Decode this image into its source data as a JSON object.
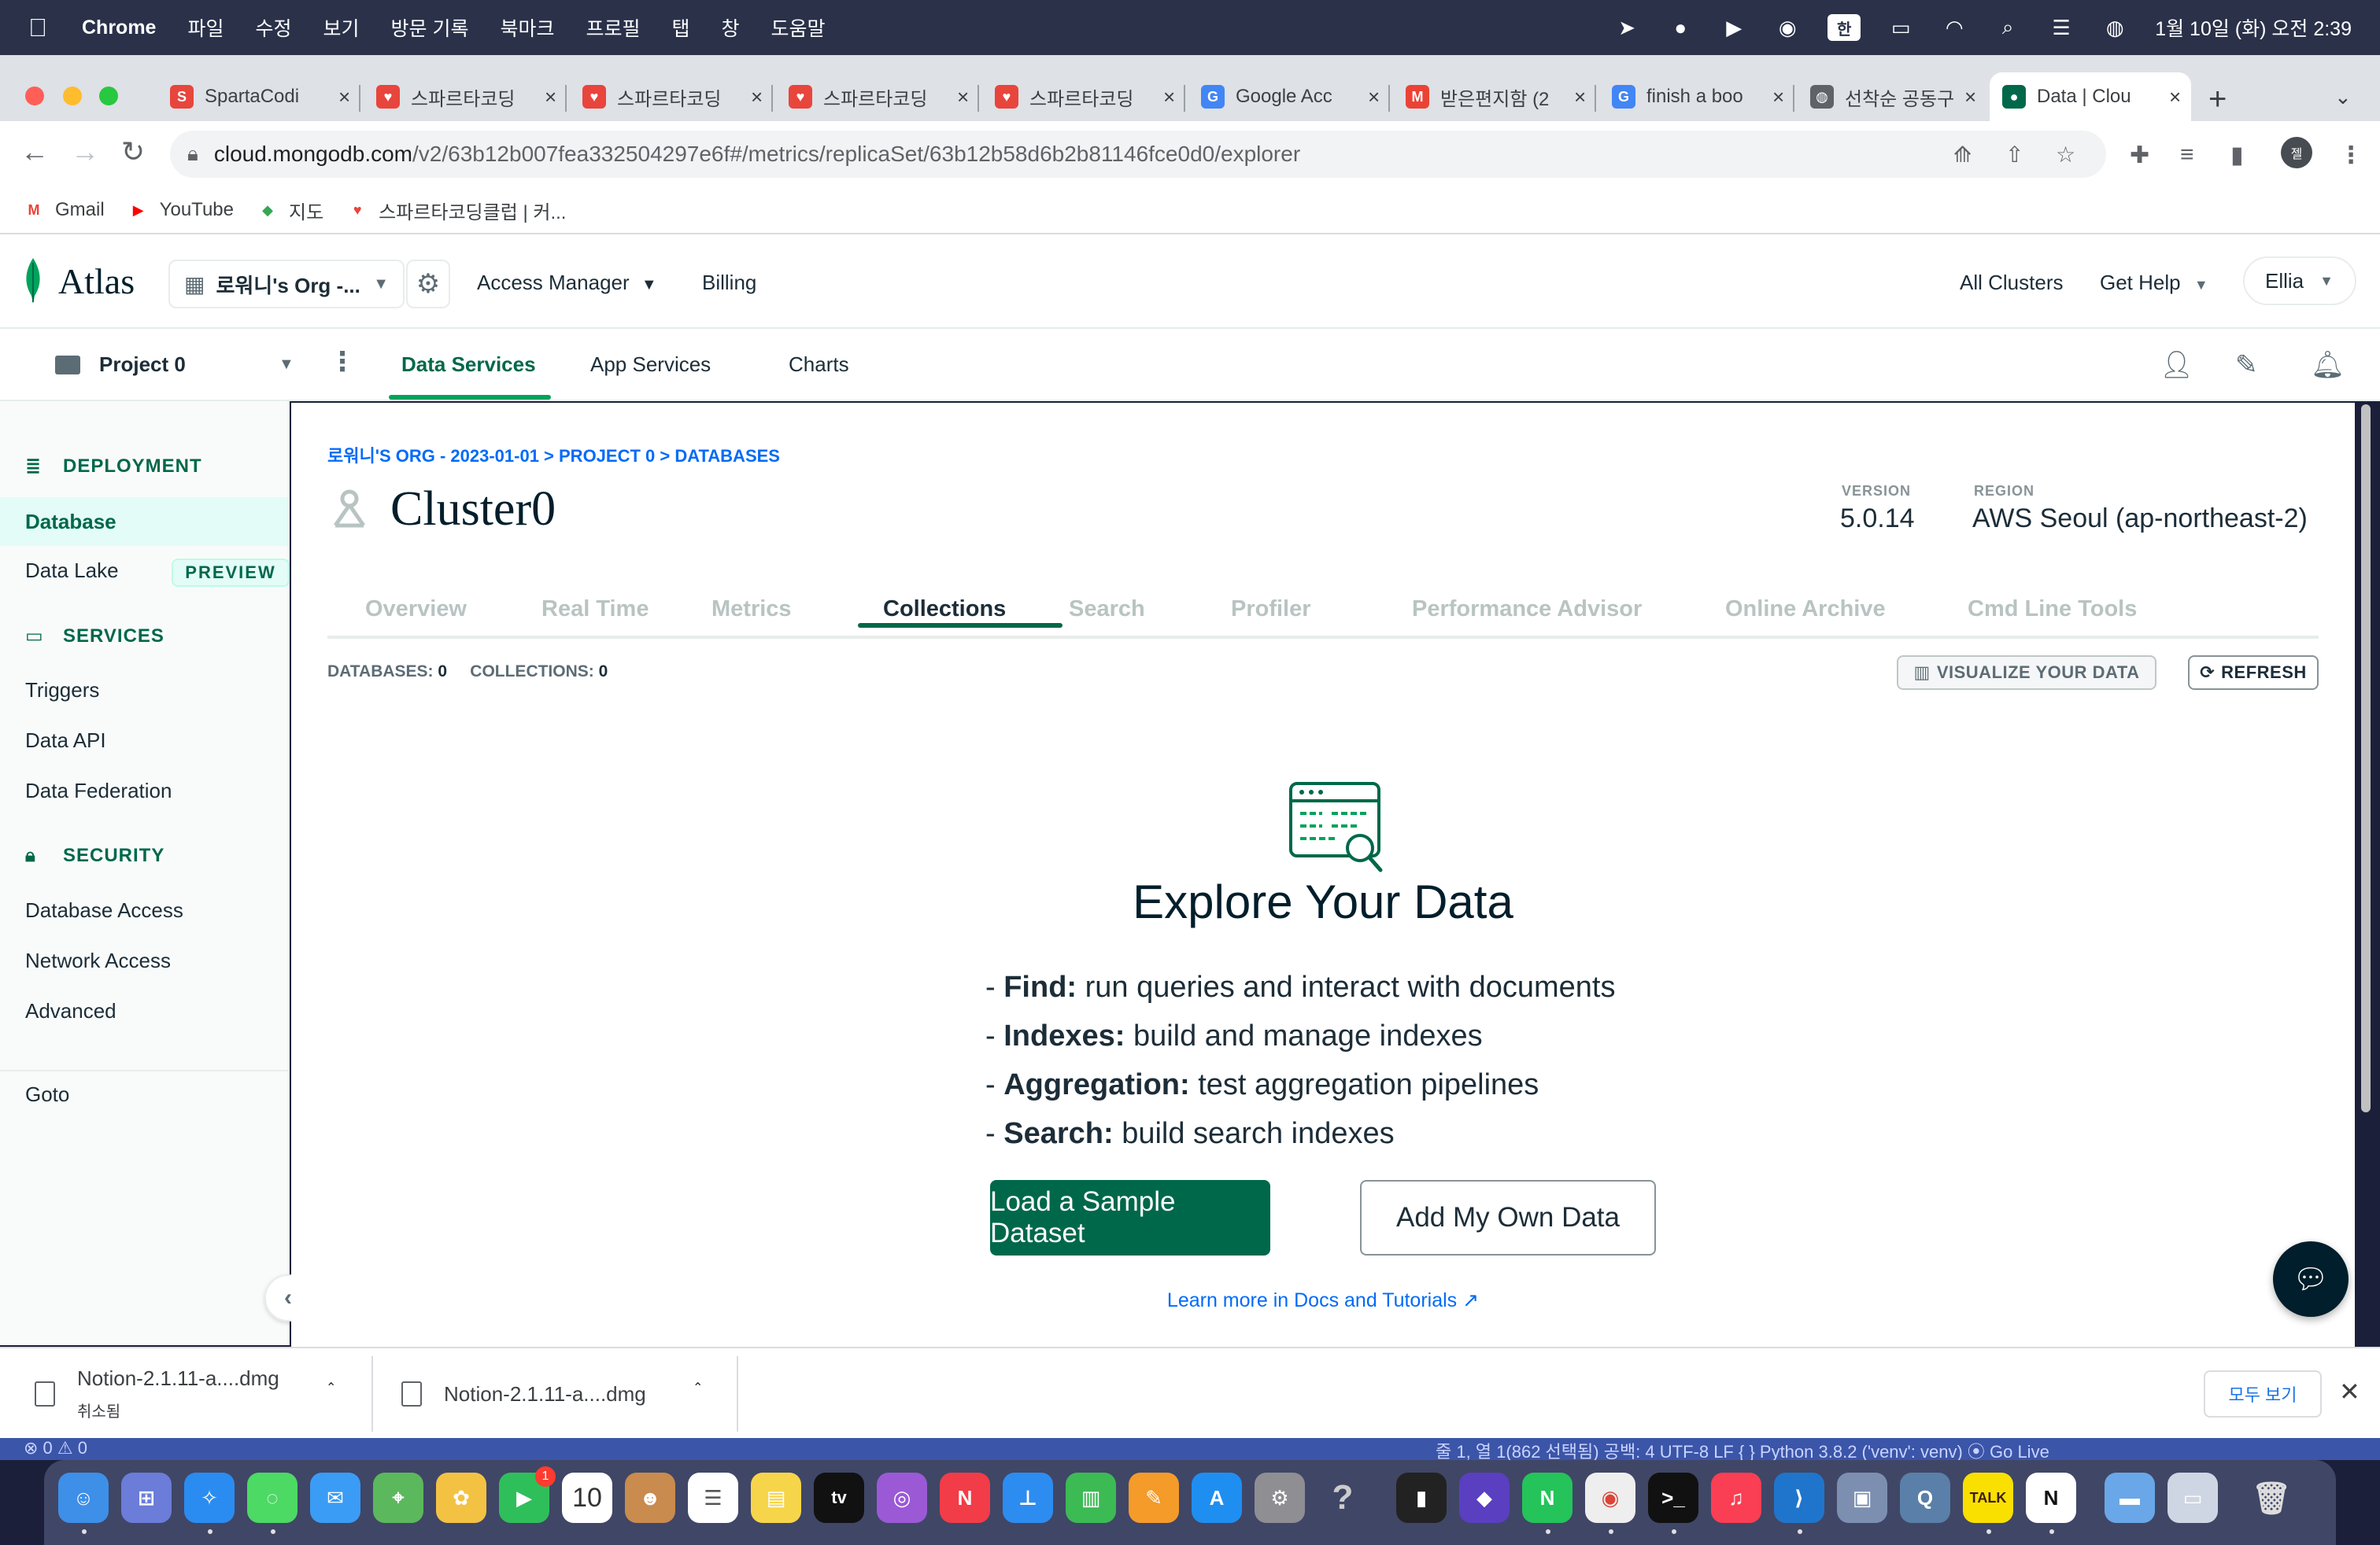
{
  "menubar": {
    "app": "Chrome",
    "items": [
      "파일",
      "수정",
      "보기",
      "방문 기록",
      "북마크",
      "프로필",
      "탭",
      "창",
      "도움말"
    ],
    "ime": "한",
    "datetime": "1월 10일 (화) 오전 2:39"
  },
  "tabs": [
    {
      "title": "SpartaCodi",
      "color": "#e8453c",
      "glyph": "S"
    },
    {
      "title": "스파르타코딩",
      "color": "#e8453c",
      "glyph": "♥"
    },
    {
      "title": "스파르타코딩",
      "color": "#e8453c",
      "glyph": "♥"
    },
    {
      "title": "스파르타코딩",
      "color": "#e8453c",
      "glyph": "♥"
    },
    {
      "title": "스파르타코딩",
      "color": "#e8453c",
      "glyph": "♥"
    },
    {
      "title": "Google Acc",
      "color": "#4285f4",
      "glyph": "G"
    },
    {
      "title": "받은편지함 (2",
      "color": "#ea4335",
      "glyph": "M"
    },
    {
      "title": "finish a boo",
      "color": "#4285f4",
      "glyph": "G"
    },
    {
      "title": "선착순 공동구",
      "color": "#5f6368",
      "glyph": "◍"
    },
    {
      "title": "Data | Clou",
      "color": "#00684a",
      "glyph": "●"
    }
  ],
  "address": {
    "host": "cloud.mongodb.com",
    "path": "/v2/63b12b007fea332504297e6f#/metrics/replicaSet/63b12b58d6b2b81146fce0d0/explorer",
    "profile": "젤"
  },
  "bookmarks": [
    {
      "label": "Gmail",
      "glyph": "M",
      "color": "#ea4335"
    },
    {
      "label": "YouTube",
      "glyph": "▶",
      "color": "#ff0000"
    },
    {
      "label": "지도",
      "glyph": "◆",
      "color": "#34a853"
    },
    {
      "label": "스파르타코딩클럽 | 커...",
      "glyph": "♥",
      "color": "#e8453c"
    }
  ],
  "atlas": {
    "logo": "Atlas",
    "org": "로워니's Org -...",
    "access_manager": "Access Manager",
    "billing": "Billing",
    "all_clusters": "All Clusters",
    "get_help": "Get Help",
    "user": "Ellia"
  },
  "project": {
    "name": "Project 0",
    "tabs": [
      "Data Services",
      "App Services",
      "Charts"
    ]
  },
  "sidebar": {
    "deployment": "DEPLOYMENT",
    "database": "Database",
    "data_lake": "Data Lake",
    "preview": "PREVIEW",
    "services": "SERVICES",
    "triggers": "Triggers",
    "data_api": "Data API",
    "data_federation": "Data Federation",
    "security": "SECURITY",
    "database_access": "Database Access",
    "network_access": "Network Access",
    "advanced": "Advanced",
    "goto": "Goto"
  },
  "main": {
    "breadcrumb": "로워니'S ORG - 2023-01-01 > PROJECT 0 > DATABASES",
    "cluster": "Cluster0",
    "version_label": "VERSION",
    "version": "5.0.14",
    "region_label": "REGION",
    "region": "AWS Seoul (ap-northeast-2)",
    "tabs": [
      "Overview",
      "Real Time",
      "Metrics",
      "Collections",
      "Search",
      "Profiler",
      "Performance Advisor",
      "Online Archive",
      "Cmd Line Tools"
    ],
    "active_tab": "Collections",
    "databases_label": "DATABASES:",
    "databases_count": "0",
    "collections_label": "COLLECTIONS:",
    "collections_count": "0",
    "visualize": "VISUALIZE YOUR DATA",
    "refresh": "REFRESH",
    "explore_title": "Explore Your Data",
    "features": [
      {
        "key": "Find:",
        "text": "run queries and interact with documents"
      },
      {
        "key": "Indexes:",
        "text": "build and manage indexes"
      },
      {
        "key": "Aggregation:",
        "text": "test aggregation pipelines"
      },
      {
        "key": "Search:",
        "text": "build search indexes"
      }
    ],
    "load_sample": "Load a Sample Dataset",
    "add_own": "Add My Own Data",
    "learn_more": "Learn more in Docs and Tutorials"
  },
  "downloads": [
    {
      "name": "Notion-2.1.11-a....dmg",
      "status": "취소됨"
    },
    {
      "name": "Notion-2.1.11-a....dmg",
      "status": ""
    }
  ],
  "downloads_show_all": "모두 보기",
  "statusstrip": {
    "left": "⊗ 0 ⚠ 0",
    "right": "줄 1, 열 1(862 선택됨)    공백: 4    UTF-8    LF    { } Python    3.8.2 ('venv': venv)    ⦿ Go Live"
  },
  "dock_badge": "1",
  "calendar_day": "10",
  "colors": {
    "atlas_green": "#00684a",
    "accent": "#00a35c",
    "link": "#016bf8"
  }
}
